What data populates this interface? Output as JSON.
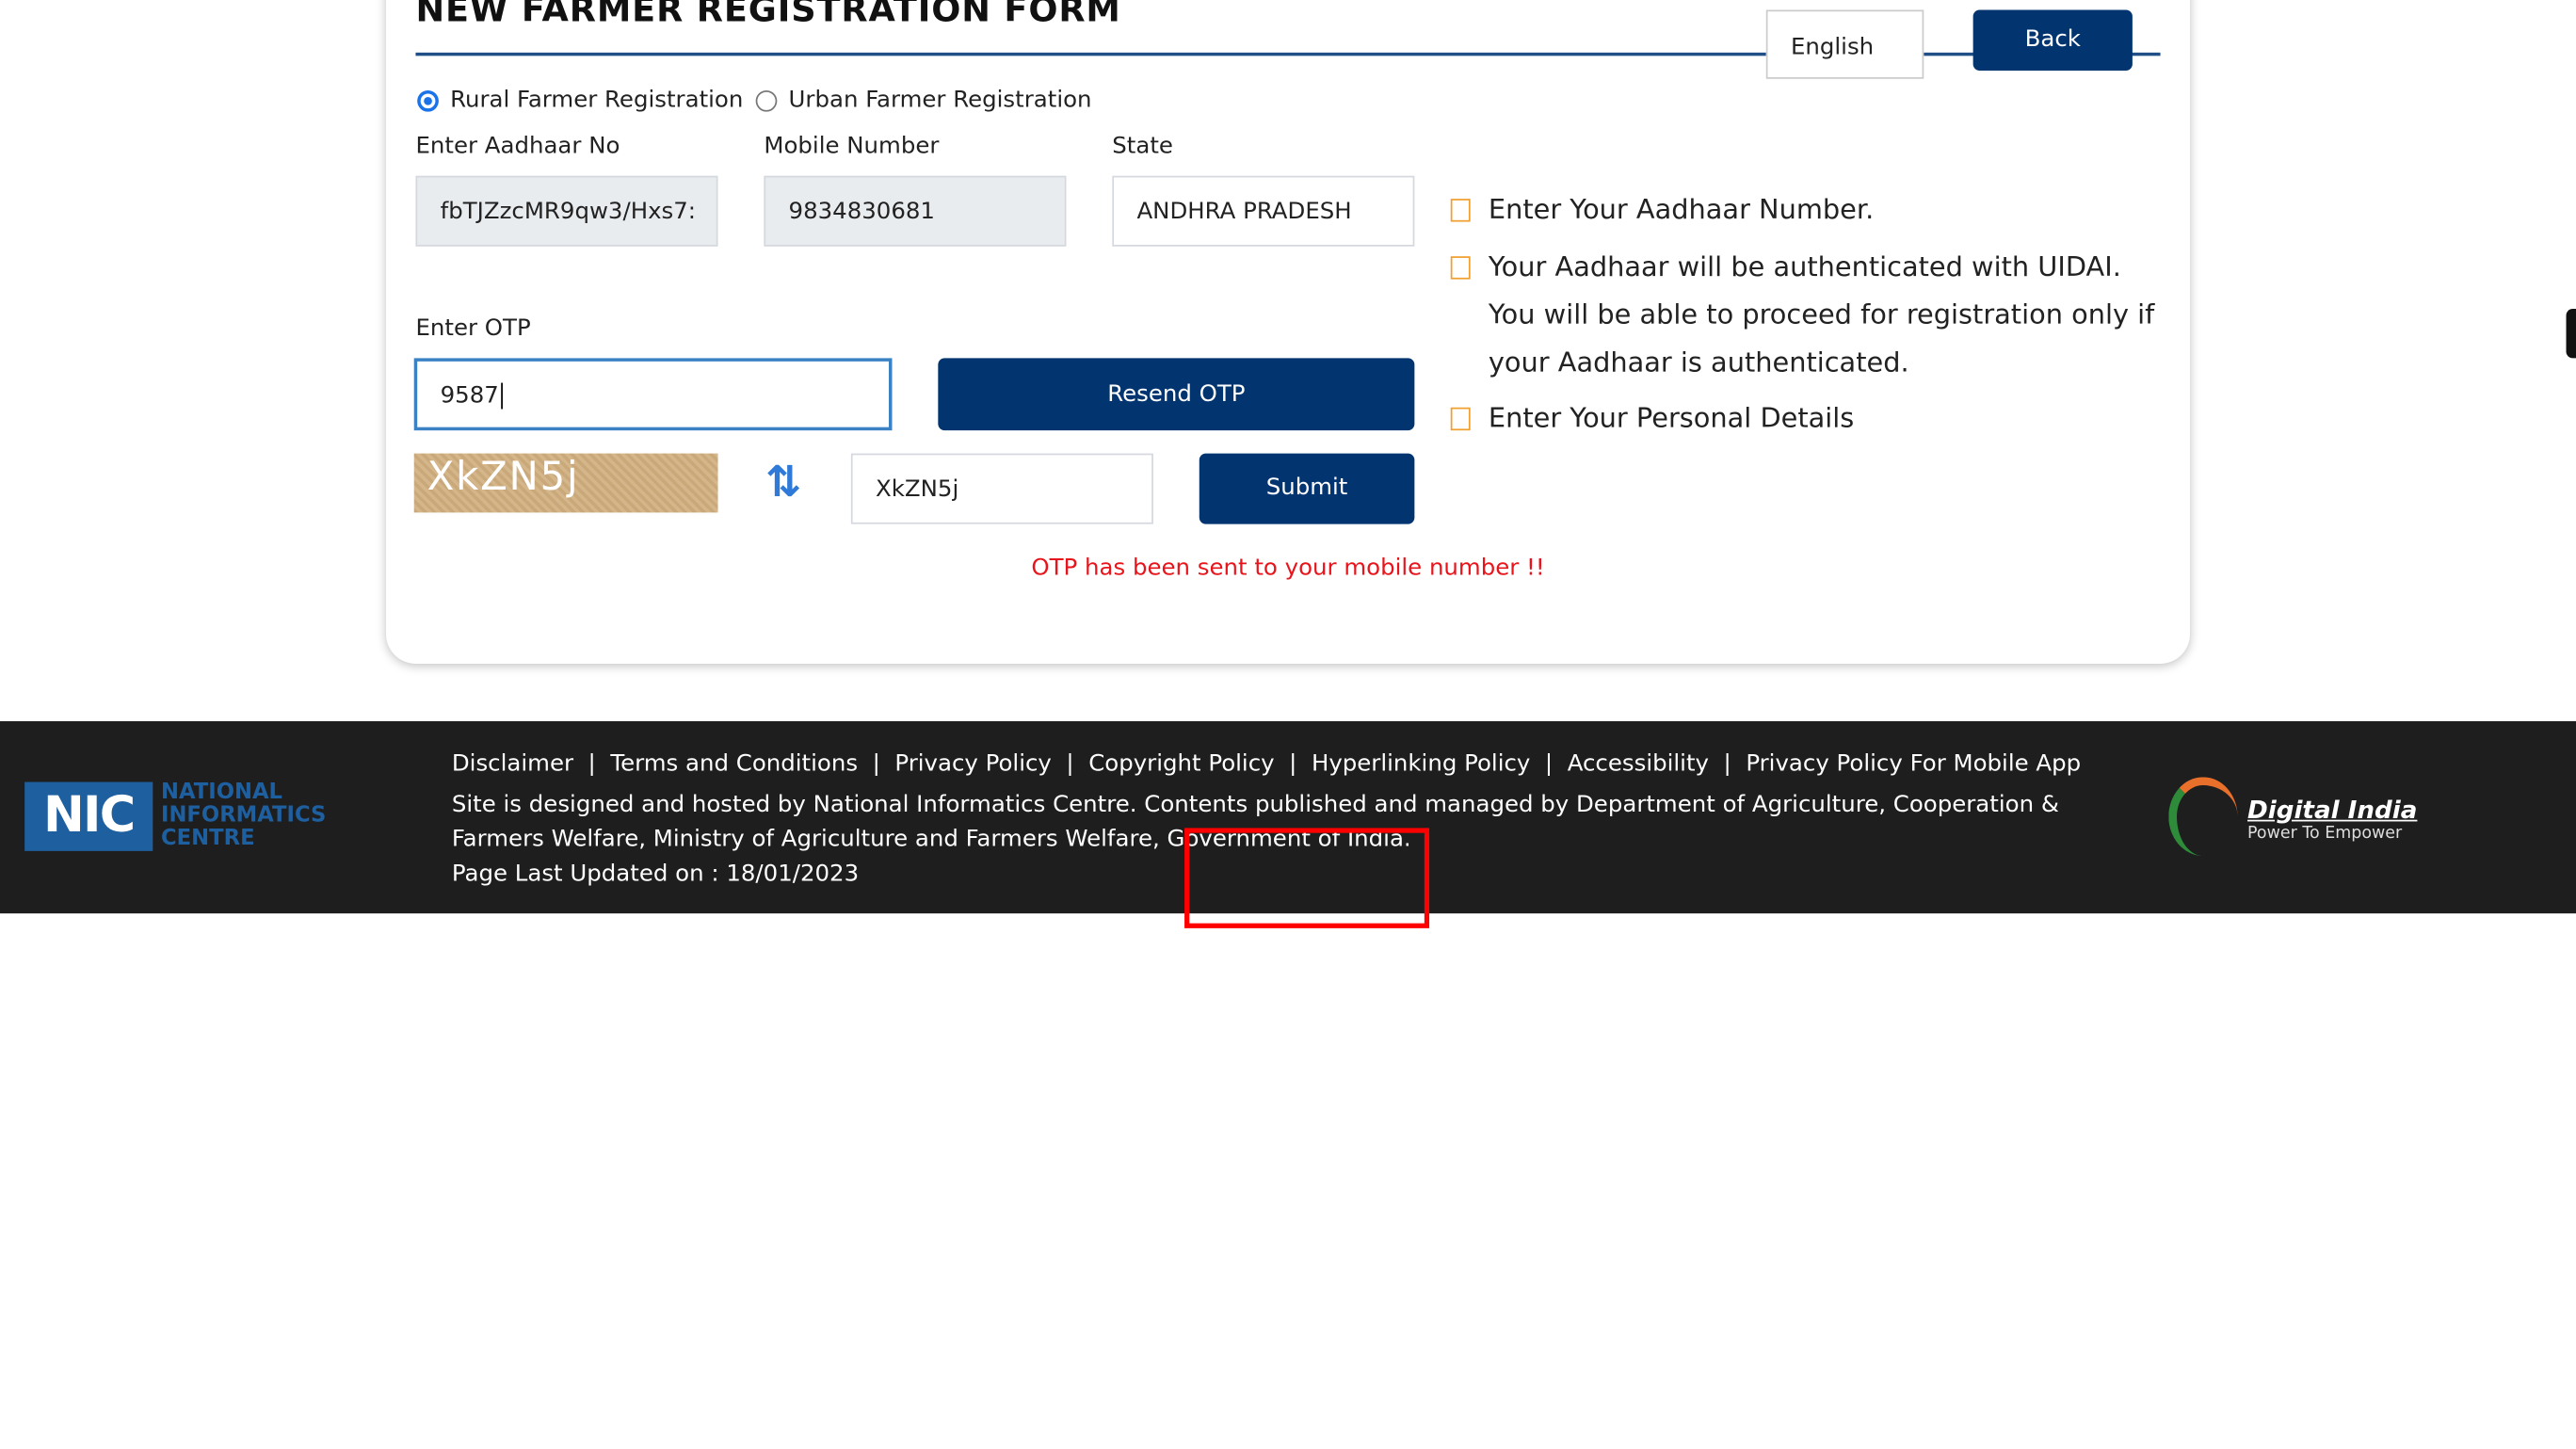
{
  "form": {
    "title": "NEW FARMER REGISTRATION FORM",
    "language": "English",
    "back_label": "Back",
    "radio_rural": "Rural Farmer Registration",
    "radio_urban": "Urban Farmer Registration",
    "selected_type": "rural",
    "aadhaar_label": "Enter Aadhaar No",
    "aadhaar_value": "fbTJZzcMR9qw3/Hxs7:",
    "mobile_label": "Mobile Number",
    "mobile_value": "9834830681",
    "state_label": "State",
    "state_value": "ANDHRA PRADESH",
    "otp_label": "Enter OTP",
    "otp_value": "9587",
    "resend_label": "Resend OTP",
    "captcha_text": "XkZN5j",
    "captcha_value": "XkZN5j",
    "submit_label": "Submit",
    "message": "OTP has been sent to your mobile number !!"
  },
  "steps": [
    "Enter Your Aadhaar Number.",
    "Your Aadhaar will be authenticated with UIDAI.",
    "You will be able to proceed for registration only if",
    "your Aadhaar is authenticated.",
    "Enter Your Personal Details"
  ],
  "footer": {
    "links": [
      "Disclaimer",
      "Terms and Conditions",
      "Privacy Policy",
      "Copyright Policy",
      "Hyperlinking Policy",
      "Accessibility",
      "Privacy Policy For Mobile App"
    ],
    "line1": "Site is designed and hosted by National Informatics Centre. Contents published and managed by Department of Agriculture, Cooperation &",
    "line2": "Farmers Welfare, Ministry of Agriculture and Farmers Welfare, Government of India.",
    "updated": "Page Last Updated on : 18/01/2023",
    "nic_logo": "NIC NATIONAL INFORMATICS CENTRE",
    "di_logo": "Digital India",
    "di_tagline": "Power To Empower"
  },
  "colors": {
    "primary": "#023570",
    "error": "#e8141b",
    "footer": "#1e1e1e"
  }
}
